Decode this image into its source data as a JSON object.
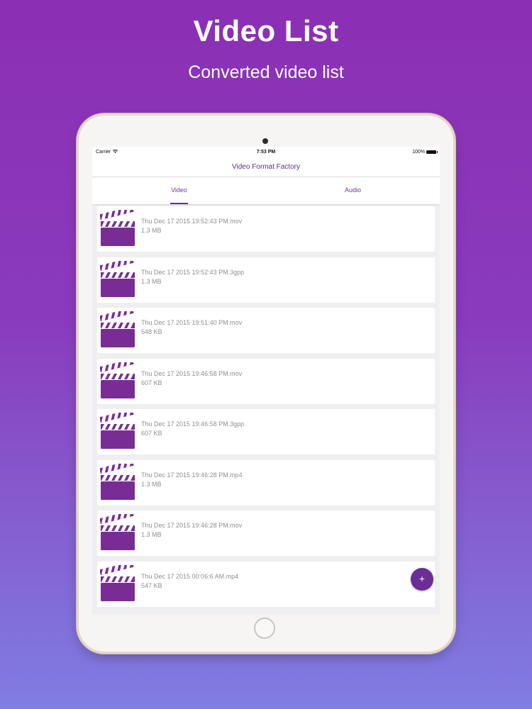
{
  "hero": {
    "title": "Video List",
    "subtitle": "Converted video list"
  },
  "status_bar": {
    "carrier": "Carrier",
    "time": "7:53 PM",
    "battery": "100%"
  },
  "nav": {
    "title": "Video Format Factory"
  },
  "tabs": [
    {
      "label": "Video",
      "selected": true
    },
    {
      "label": "Audio",
      "selected": false
    }
  ],
  "videos": [
    {
      "name": "Thu Dec 17 2015 19:52:43 PM.mov",
      "size": "1.3 MB"
    },
    {
      "name": "Thu Dec 17 2015 19:52:43 PM.3gpp",
      "size": "1.3 MB"
    },
    {
      "name": "Thu Dec 17 2015 19:51:40 PM.mov",
      "size": "548 KB"
    },
    {
      "name": "Thu Dec 17 2015 19:46:58 PM.mov",
      "size": "607 KB"
    },
    {
      "name": "Thu Dec 17 2015 19:46:58 PM.3gpp",
      "size": "607 KB"
    },
    {
      "name": "Thu Dec 17 2015 19:46:28 PM.mp4",
      "size": "1.3 MB"
    },
    {
      "name": "Thu Dec 17 2015 19:46:28 PM.mov",
      "size": "1.3 MB"
    },
    {
      "name": "Thu Dec 17 2015 00:06:6 AM.mp4",
      "size": "547 KB"
    }
  ],
  "fab": {
    "icon": "plus-icon",
    "label": "+"
  },
  "colors": {
    "accent": "#6b2d96",
    "background_top": "#8b2fb4",
    "background_bottom": "#7f7ee3"
  }
}
